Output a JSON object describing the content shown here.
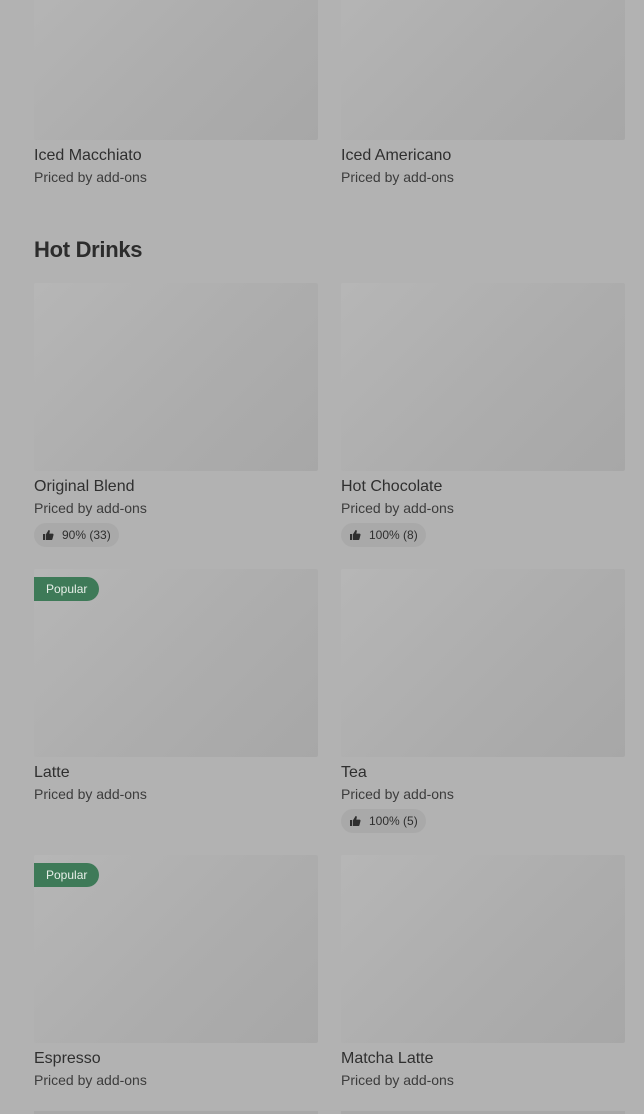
{
  "iced_items": [
    {
      "name": "Iced Macchiato",
      "price": "Priced by add-ons"
    },
    {
      "name": "Iced Americano",
      "price": "Priced by add-ons"
    }
  ],
  "hot_drinks": {
    "title": "Hot Drinks",
    "items": [
      {
        "name": "Original Blend",
        "price": "Priced by add-ons",
        "rating": "90% (33)"
      },
      {
        "name": "Hot Chocolate",
        "price": "Priced by add-ons",
        "rating": "100% (8)"
      },
      {
        "name": "Latte",
        "price": "Priced by add-ons",
        "badge": "Popular"
      },
      {
        "name": "Tea",
        "price": "Priced by add-ons",
        "rating": "100% (5)"
      },
      {
        "name": "Espresso",
        "price": "Priced by add-ons",
        "badge": "Popular"
      },
      {
        "name": "Matcha Latte",
        "price": "Priced by add-ons"
      }
    ]
  },
  "colors": {
    "badge_bg": "#3e7a58",
    "overlay": "#b2b2b2"
  },
  "icons": {
    "rating": "thumbs-up-icon"
  }
}
